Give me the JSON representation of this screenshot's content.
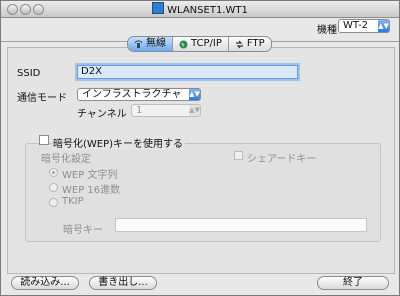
{
  "window": {
    "title": "WLANSET1.WT1"
  },
  "header": {
    "model_label": "機種",
    "model_value": "WT-2"
  },
  "tabs": [
    {
      "label": "無線",
      "icon": "wireless-icon",
      "active": true
    },
    {
      "label": "TCP/IP",
      "icon": "globe-icon",
      "active": false
    },
    {
      "label": "FTP",
      "icon": "ftp-icon",
      "active": false
    }
  ],
  "form": {
    "ssid_label": "SSID",
    "ssid_value": "D2X",
    "mode_label": "通信モード",
    "mode_value": "インフラストラクチャ",
    "channel_label": "チャンネル",
    "channel_value": "1",
    "wep_label": "暗号化(WEP)キーを使用する",
    "wep_checked": false
  },
  "encryption": {
    "setting_label": "暗号化設定",
    "shared_key_label": "シェアードキー",
    "options": [
      {
        "label": "WEP 文字列",
        "selected": true
      },
      {
        "label": "WEP 16進数",
        "selected": false
      },
      {
        "label": "TKIP",
        "selected": false
      }
    ],
    "key_label": "暗号キー",
    "key_value": ""
  },
  "footer": {
    "load_label": "読み込み...",
    "write_label": "書き出し...",
    "quit_label": "終了"
  },
  "colors": {
    "accent": "#6aaaf0",
    "focus": "#9cc4f0"
  }
}
